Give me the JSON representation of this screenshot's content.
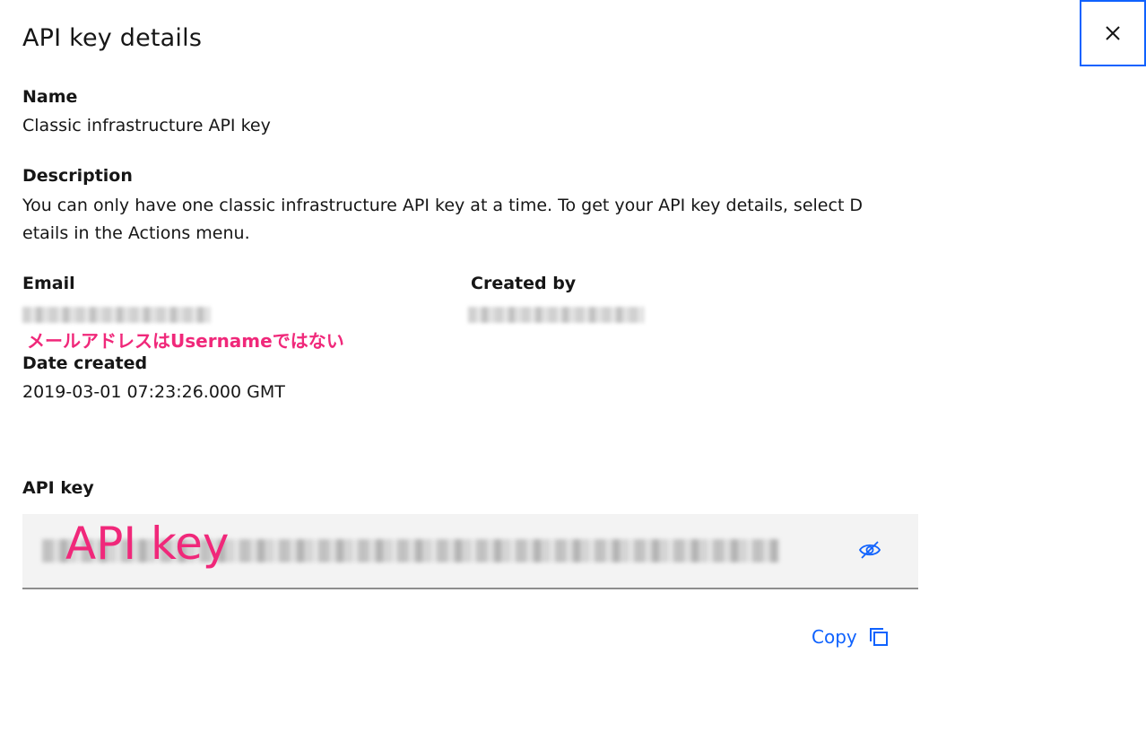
{
  "header": {
    "title": "API key details",
    "close_icon": "close-icon"
  },
  "details": {
    "name_label": "Name",
    "name_value": "Classic infrastructure API key",
    "description_label": "Description",
    "description_value_line1": "You can only have one classic infrastructure API key at a time. To get your API key details, select D",
    "description_value_line2": "etails in the Actions menu.",
    "email_label": "Email",
    "created_by_label": "Created by",
    "annotation_email": "メールアドレスはUsernameではない",
    "date_created_label": "Date created",
    "date_created_value": "2019-03-01 07:23:26.000 GMT"
  },
  "api_key": {
    "label": "API key",
    "annotation": "API key",
    "toggle_icon": "view-off-icon"
  },
  "actions": {
    "copy_label": "Copy",
    "copy_icon": "copy-icon"
  },
  "colors": {
    "accent": "#0f62fe",
    "annotation": "#f0287a",
    "field_bg": "#f3f3f3"
  }
}
